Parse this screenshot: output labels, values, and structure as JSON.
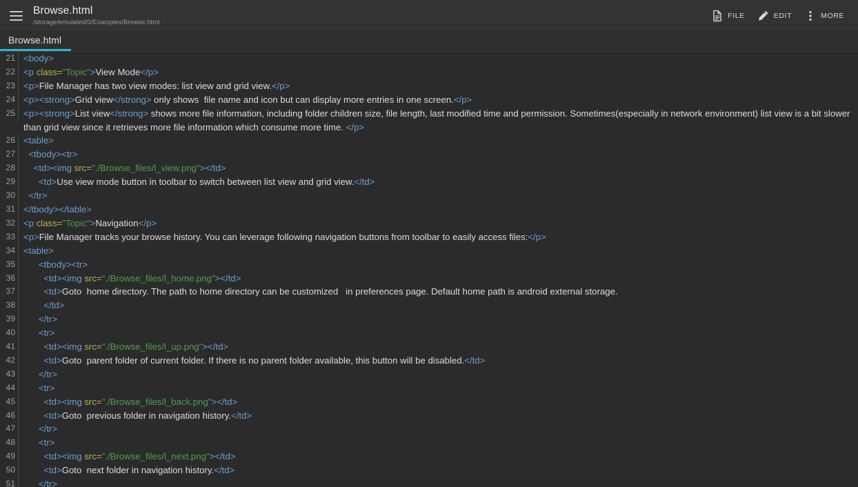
{
  "appbar": {
    "menu_icon": "hamburger-icon",
    "title": "Browse.html",
    "subtitle": "/storage/emulated/0/Examples/Browse.html",
    "actions": [
      {
        "icon": "file-icon",
        "label": "FILE"
      },
      {
        "icon": "pencil-icon",
        "label": "EDIT"
      },
      {
        "icon": "more-vert-icon",
        "label": "MORE"
      }
    ]
  },
  "tabs": [
    {
      "label": "Browse.html",
      "active": true
    }
  ],
  "editor": {
    "accent_color": "#29b6d8",
    "background_color": "#2b2b2b",
    "appbar_color": "#333333",
    "gutter_color": "#9d9d9d",
    "colors": {
      "tag": "#6a9fd4",
      "attribute": "#b9b54a",
      "value": "#4f9e4f",
      "text": "#dcdcdc"
    },
    "lines": [
      {
        "num": "21",
        "indent": 0,
        "tokens": [
          {
            "t": "tag",
            "s": "<body>"
          }
        ]
      },
      {
        "num": "22",
        "indent": 0,
        "tokens": [
          {
            "t": "tag",
            "s": "<p "
          },
          {
            "t": "attr",
            "s": "class="
          },
          {
            "t": "val",
            "s": "\"Topic\""
          },
          {
            "t": "tag",
            "s": ">"
          },
          {
            "t": "text",
            "s": "View Mode"
          },
          {
            "t": "tag",
            "s": "</p>"
          }
        ]
      },
      {
        "num": "23",
        "indent": 0,
        "tokens": [
          {
            "t": "tag",
            "s": "<p>"
          },
          {
            "t": "text",
            "s": "File Manager has two view modes: list view and grid view."
          },
          {
            "t": "tag",
            "s": "</p>"
          }
        ]
      },
      {
        "num": "24",
        "indent": 0,
        "tokens": [
          {
            "t": "tag",
            "s": "<p><strong>"
          },
          {
            "t": "text",
            "s": "Grid view"
          },
          {
            "t": "tag",
            "s": "</strong>"
          },
          {
            "t": "text",
            "s": " only shows  file name and icon but can display more entries in one screen."
          },
          {
            "t": "tag",
            "s": "</p>"
          }
        ]
      },
      {
        "num": "25",
        "indent": 0,
        "tokens": [
          {
            "t": "tag",
            "s": "<p><strong>"
          },
          {
            "t": "text",
            "s": "List view"
          },
          {
            "t": "tag",
            "s": "</strong>"
          },
          {
            "t": "text",
            "s": " shows more file information, including folder children size, file length, last modified time and permission. Sometimes(especially in network environment) list view is a bit slower than grid view since it retrieves more file information which consume more time. "
          },
          {
            "t": "tag",
            "s": "</p>"
          }
        ]
      },
      {
        "num": "26",
        "indent": 0,
        "tokens": [
          {
            "t": "tag",
            "s": "<table>"
          }
        ]
      },
      {
        "num": "27",
        "indent": 1,
        "tokens": [
          {
            "t": "tag",
            "s": "<tbody><tr>"
          }
        ]
      },
      {
        "num": "28",
        "indent": 2,
        "tokens": [
          {
            "t": "tag",
            "s": "<td><img "
          },
          {
            "t": "attr",
            "s": "src="
          },
          {
            "t": "val",
            "s": "\"./Browse_files/l_view.png\""
          },
          {
            "t": "tag",
            "s": "></td>"
          }
        ]
      },
      {
        "num": "29",
        "indent": 3,
        "tokens": [
          {
            "t": "tag",
            "s": "<td>"
          },
          {
            "t": "text",
            "s": "Use view mode button in toolbar to switch between list view and grid view."
          },
          {
            "t": "tag",
            "s": "</td>"
          }
        ]
      },
      {
        "num": "30",
        "indent": 1,
        "tokens": [
          {
            "t": "tag",
            "s": "</tr>"
          }
        ]
      },
      {
        "num": "31",
        "indent": 0,
        "tokens": [
          {
            "t": "tag",
            "s": "</tbody></table>"
          }
        ]
      },
      {
        "num": "32",
        "indent": 0,
        "tokens": [
          {
            "t": "tag",
            "s": "<p "
          },
          {
            "t": "attr",
            "s": "class="
          },
          {
            "t": "val",
            "s": "\"Topic\""
          },
          {
            "t": "tag",
            "s": ">"
          },
          {
            "t": "text",
            "s": "Navigation"
          },
          {
            "t": "tag",
            "s": "</p>"
          }
        ]
      },
      {
        "num": "33",
        "indent": 0,
        "tokens": [
          {
            "t": "tag",
            "s": "<p>"
          },
          {
            "t": "text",
            "s": "File Manager tracks your browse history. You can leverage following navigation buttons from toolbar to easily access files:"
          },
          {
            "t": "tag",
            "s": "</p>"
          }
        ]
      },
      {
        "num": "34",
        "indent": 0,
        "tokens": [
          {
            "t": "tag",
            "s": "<table>"
          }
        ]
      },
      {
        "num": "35",
        "indent": 3,
        "tokens": [
          {
            "t": "tag",
            "s": "<tbody><tr>"
          }
        ]
      },
      {
        "num": "36",
        "indent": 4,
        "tokens": [
          {
            "t": "tag",
            "s": "<td><img "
          },
          {
            "t": "attr",
            "s": "src="
          },
          {
            "t": "val",
            "s": "\"./Browse_files/l_home.png\""
          },
          {
            "t": "tag",
            "s": "></td>"
          }
        ]
      },
      {
        "num": "37",
        "indent": 4,
        "tokens": [
          {
            "t": "tag",
            "s": "<td>"
          },
          {
            "t": "text",
            "s": "Goto  home directory. The path to home directory can be customized   in preferences page. Default home path is android external storage."
          }
        ]
      },
      {
        "num": "38",
        "indent": 4,
        "tokens": [
          {
            "t": "tag",
            "s": "</td>"
          }
        ]
      },
      {
        "num": "39",
        "indent": 3,
        "tokens": [
          {
            "t": "tag",
            "s": "</tr>"
          }
        ]
      },
      {
        "num": "40",
        "indent": 3,
        "tokens": [
          {
            "t": "tag",
            "s": "<tr>"
          }
        ]
      },
      {
        "num": "41",
        "indent": 4,
        "tokens": [
          {
            "t": "tag",
            "s": "<td><img "
          },
          {
            "t": "attr",
            "s": "src="
          },
          {
            "t": "val",
            "s": "\"./Browse_files/l_up.png\""
          },
          {
            "t": "tag",
            "s": "></td>"
          }
        ]
      },
      {
        "num": "42",
        "indent": 4,
        "tokens": [
          {
            "t": "tag",
            "s": "<td>"
          },
          {
            "t": "text",
            "s": "Goto  parent folder of current folder. If there is no parent folder available, this button will be disabled."
          },
          {
            "t": "tag",
            "s": "</td>"
          }
        ]
      },
      {
        "num": "43",
        "indent": 3,
        "tokens": [
          {
            "t": "tag",
            "s": "</tr>"
          }
        ]
      },
      {
        "num": "44",
        "indent": 3,
        "tokens": [
          {
            "t": "tag",
            "s": "<tr>"
          }
        ]
      },
      {
        "num": "45",
        "indent": 4,
        "tokens": [
          {
            "t": "tag",
            "s": "<td><img "
          },
          {
            "t": "attr",
            "s": "src="
          },
          {
            "t": "val",
            "s": "\"./Browse_files/l_back.png\""
          },
          {
            "t": "tag",
            "s": "></td>"
          }
        ]
      },
      {
        "num": "46",
        "indent": 4,
        "tokens": [
          {
            "t": "tag",
            "s": "<td>"
          },
          {
            "t": "text",
            "s": "Goto  previous folder in navigation history."
          },
          {
            "t": "tag",
            "s": "</td>"
          }
        ]
      },
      {
        "num": "47",
        "indent": 3,
        "tokens": [
          {
            "t": "tag",
            "s": "</tr>"
          }
        ]
      },
      {
        "num": "48",
        "indent": 3,
        "tokens": [
          {
            "t": "tag",
            "s": "<tr>"
          }
        ]
      },
      {
        "num": "49",
        "indent": 4,
        "tokens": [
          {
            "t": "tag",
            "s": "<td><img "
          },
          {
            "t": "attr",
            "s": "src="
          },
          {
            "t": "val",
            "s": "\"./Browse_files/l_next.png\""
          },
          {
            "t": "tag",
            "s": "></td>"
          }
        ]
      },
      {
        "num": "50",
        "indent": 4,
        "tokens": [
          {
            "t": "tag",
            "s": "<td>"
          },
          {
            "t": "text",
            "s": "Goto  next folder in navigation history."
          },
          {
            "t": "tag",
            "s": "</td>"
          }
        ]
      },
      {
        "num": "51",
        "indent": 3,
        "tokens": [
          {
            "t": "tag",
            "s": "</tr>"
          }
        ]
      }
    ]
  }
}
